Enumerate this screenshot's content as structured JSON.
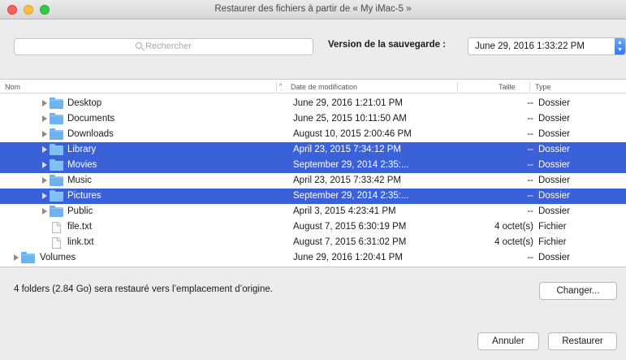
{
  "window": {
    "title": "Restaurer des fichiers à partir de « My iMac-5 »"
  },
  "toolbar": {
    "search_placeholder": "Rechercher",
    "version_label": "Version de la sauvegarde :",
    "version_value": "June 29, 2016 1:33:22 PM"
  },
  "table": {
    "headers": {
      "name": "Nom",
      "date": "Date de modification",
      "size": "Taille",
      "type": "Type"
    },
    "rows": [
      {
        "name": "Desktop",
        "date": "June 29, 2016 1:21:01 PM",
        "size": "--",
        "type": "Dossier"
      },
      {
        "name": "Documents",
        "date": "June 25, 2015 10:11:50 AM",
        "size": "--",
        "type": "Dossier"
      },
      {
        "name": "Downloads",
        "date": "August 10, 2015 2:00:46 PM",
        "size": "--",
        "type": "Dossier"
      },
      {
        "name": "Library",
        "date": "April 23, 2015 7:34:12 PM",
        "size": "--",
        "type": "Dossier"
      },
      {
        "name": "Movies",
        "date": "September 29, 2014 2:35:...",
        "size": "--",
        "type": "Dossier"
      },
      {
        "name": "Music",
        "date": "April 23, 2015 7:33:42 PM",
        "size": "--",
        "type": "Dossier"
      },
      {
        "name": "Pictures",
        "date": "September 29, 2014 2:35:...",
        "size": "--",
        "type": "Dossier"
      },
      {
        "name": "Public",
        "date": "April 3, 2015 4:23:41 PM",
        "size": "--",
        "type": "Dossier"
      },
      {
        "name": "file.txt",
        "date": "August 7, 2015 6:30:19 PM",
        "size": "4 octet(s)",
        "type": "Fichier"
      },
      {
        "name": "link.txt",
        "date": "August 7, 2015 6:31:02 PM",
        "size": "4 octet(s)",
        "type": "Fichier"
      },
      {
        "name": "Volumes",
        "date": "June 29, 2016 1:20:41 PM",
        "size": "--",
        "type": "Dossier"
      }
    ]
  },
  "footer": {
    "summary": "4 folders (2.84 Go) sera restauré vers l’emplacement d’origine.",
    "change_label": "Changer...",
    "cancel_label": "Annuler",
    "restore_label": "Restaurer"
  }
}
